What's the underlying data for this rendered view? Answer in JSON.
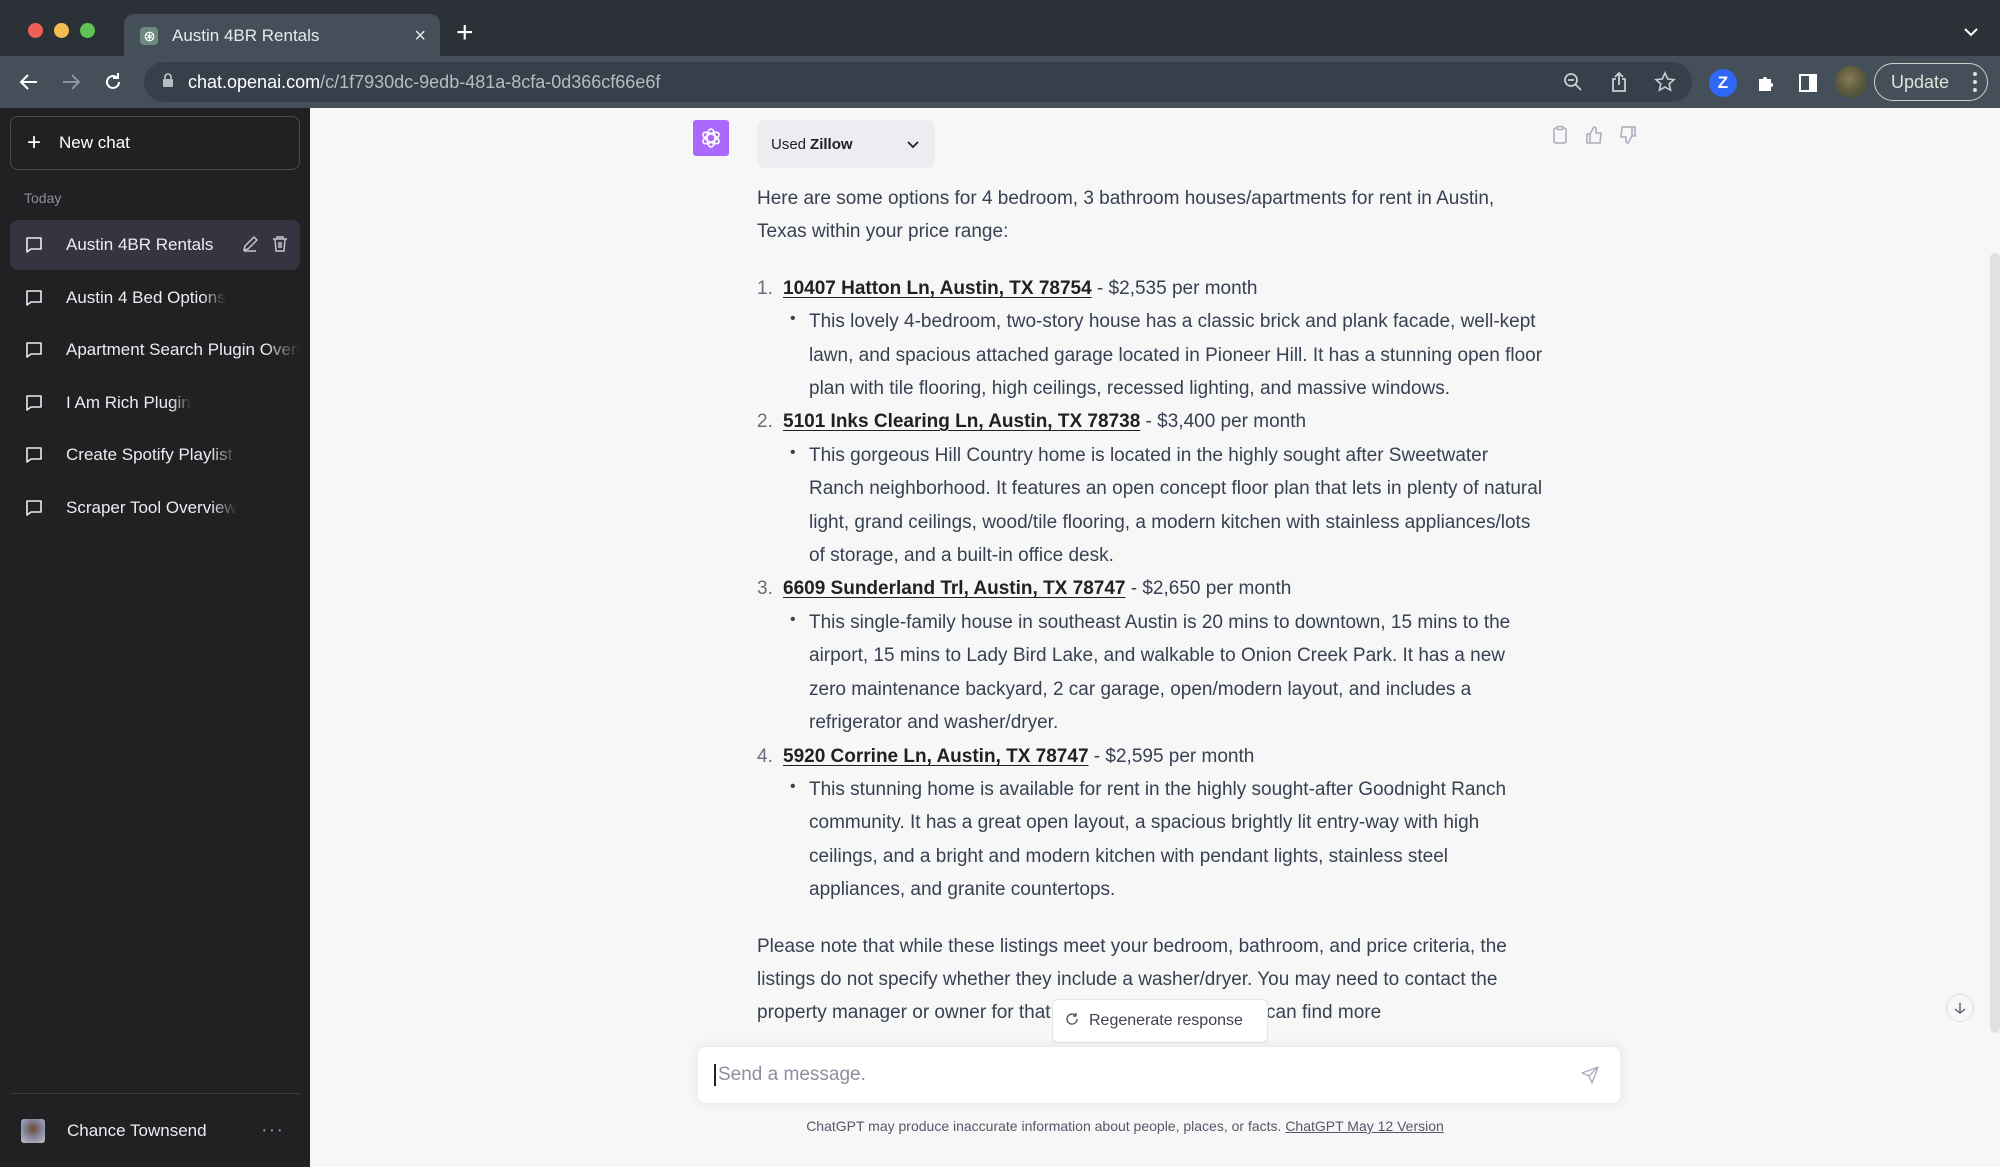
{
  "browser": {
    "tab_title": "Austin 4BR Rentals",
    "url_host": "chat.openai.com",
    "url_path": "/c/1f7930dc-9edb-481a-8cfa-0d366cf66e6f",
    "extension_z_label": "Z",
    "update_label": "Update"
  },
  "sidebar": {
    "new_chat_label": "New chat",
    "section_label": "Today",
    "chats": [
      {
        "label": "Austin 4BR Rentals",
        "active": true
      },
      {
        "label": "Austin 4 Bed Options"
      },
      {
        "label": "Apartment Search Plugin Overview"
      },
      {
        "label": "I Am Rich Plugin"
      },
      {
        "label": "Create Spotify Playlist."
      },
      {
        "label": "Scraper Tool Overview"
      }
    ],
    "user_name": "Chance Townsend",
    "user_menu": "···"
  },
  "message": {
    "plugin_prefix": "Used",
    "plugin_name": "Zillow",
    "intro": "Here are some options for 4 bedroom, 3 bathroom houses/apartments for rent in Austin, Texas within your price range:",
    "listings": [
      {
        "num": "1.",
        "address": "10407 Hatton Ln, Austin, TX 78754",
        "price": " - $2,535 per month",
        "description": "This lovely 4-bedroom, two-story house has a classic brick and plank facade, well-kept lawn, and spacious attached garage located in Pioneer Hill. It has a stunning open floor plan with tile flooring, high ceilings, recessed lighting, and massive windows."
      },
      {
        "num": "2.",
        "address": "5101 Inks Clearing Ln, Austin, TX 78738",
        "price": " - $3,400 per month",
        "description": "This gorgeous Hill Country home is located in the highly sought after Sweetwater Ranch neighborhood. It features an open concept floor plan that lets in plenty of natural light, grand ceilings, wood/tile flooring, a modern kitchen with stainless appliances/lots of storage, and a built-in office desk."
      },
      {
        "num": "3.",
        "address": "6609 Sunderland Trl, Austin, TX 78747",
        "price": " - $2,650 per month",
        "description": "This single-family house in southeast Austin is 20 mins to downtown, 15 mins to the airport, 15 mins to Lady Bird Lake, and walkable to Onion Creek Park. It has a new zero maintenance backyard, 2 car garage, open/modern layout, and includes a refrigerator and washer/dryer."
      },
      {
        "num": "4.",
        "address": "5920 Corrine Ln, Austin, TX 78747",
        "price": " - $2,595 per month",
        "description": "This stunning home is available for rent in the highly sought-after Goodnight Ranch community. It has a great open layout, a spacious brightly lit entry-way with high ceilings, and a bright and modern kitchen with pendant lights, stainless steel appliances, and granite countertops."
      }
    ],
    "note": "Please note that while these listings meet your bedroom, bathroom, and price criteria, the listings do not specify whether they include a washer/dryer. You may need to contact the property manager or owner for that specific information. You can find more"
  },
  "composer": {
    "regenerate_label": "Regenerate response",
    "placeholder": "Send a message.",
    "disclaimer": "ChatGPT may produce inaccurate information about people, places, or facts. ",
    "version_link": "ChatGPT May 12 Version"
  },
  "colors": {
    "accent_avatar": "#ab68ff",
    "sidebar_bg": "#202123",
    "main_bg": "#f7f7f8"
  }
}
